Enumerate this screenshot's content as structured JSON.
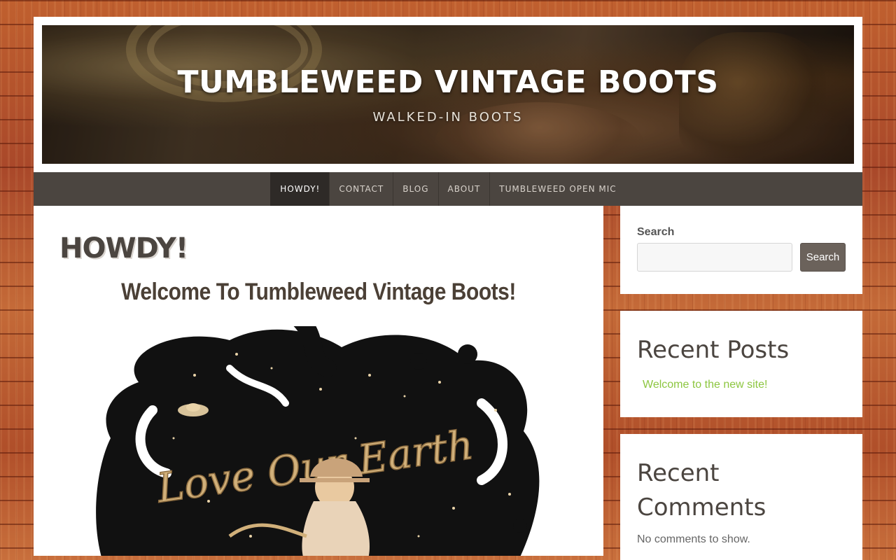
{
  "header": {
    "site_title": "TUMBLEWEED VINTAGE BOOTS",
    "tagline": "WALKED-IN BOOTS"
  },
  "nav": {
    "items": [
      {
        "label": "HOWDY!",
        "active": true
      },
      {
        "label": "CONTACT",
        "active": false
      },
      {
        "label": "BLOG",
        "active": false
      },
      {
        "label": "ABOUT",
        "active": false
      },
      {
        "label": "TUMBLEWEED OPEN MIC",
        "active": false
      }
    ]
  },
  "main": {
    "page_title": "HOWDY!",
    "welcome_heading": "Welcome To Tumbleweed Vintage Boots!",
    "art_text": "Love Our Earth"
  },
  "sidebar": {
    "search": {
      "label": "Search",
      "input_value": "",
      "button_label": "Search"
    },
    "recent_posts": {
      "title": "Recent Posts",
      "items": [
        "Welcome to the new site!"
      ]
    },
    "recent_comments": {
      "title": "Recent Comments",
      "empty_text": "No comments to show."
    }
  },
  "colors": {
    "nav_bg": "#4b4540",
    "nav_active_bg": "#2e2a27",
    "link_green": "#8cc63f",
    "button_bg": "#6b625b",
    "heading_brown": "#4b4540"
  }
}
